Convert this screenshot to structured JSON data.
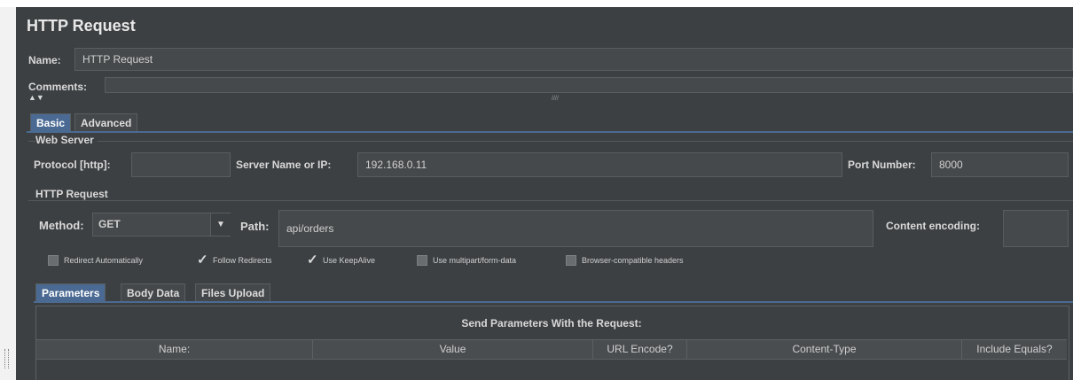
{
  "panel": {
    "title": "HTTP Request",
    "name_label": "Name:",
    "name_value": "HTTP Request",
    "comments_label": "Comments:",
    "collapse_glyph": "▲▼",
    "splitter_grip": "////"
  },
  "tabs": {
    "basic": "Basic",
    "advanced": "Advanced"
  },
  "web_server": {
    "section_title": "Web Server",
    "protocol_label": "Protocol [http]:",
    "protocol_value": "",
    "server_label": "Server Name or IP:",
    "server_value": "192.168.0.11",
    "port_label": "Port Number:",
    "port_value": "8000"
  },
  "http_request": {
    "section_title": "HTTP Request",
    "method_label": "Method:",
    "method_value": "GET",
    "path_label": "Path:",
    "path_value": "api/orders",
    "encoding_label": "Content encoding:",
    "encoding_value": ""
  },
  "options": [
    {
      "label": "Redirect Automatically",
      "checked": false
    },
    {
      "label": "Follow Redirects",
      "checked": true
    },
    {
      "label": "Use KeepAlive",
      "checked": true
    },
    {
      "label": "Use multipart/form-data",
      "checked": false
    },
    {
      "label": "Browser-compatible headers",
      "checked": false
    }
  ],
  "sub_tabs": {
    "parameters": "Parameters",
    "body_data": "Body Data",
    "files_upload": "Files Upload"
  },
  "parameters_table": {
    "caption": "Send Parameters With the Request:",
    "columns": [
      "Name:",
      "Value",
      "URL Encode?",
      "Content-Type",
      "Include Equals?"
    ]
  },
  "colors": {
    "background": "#3d4043",
    "field": "#46494b",
    "active_tab": "#4a6a93"
  }
}
